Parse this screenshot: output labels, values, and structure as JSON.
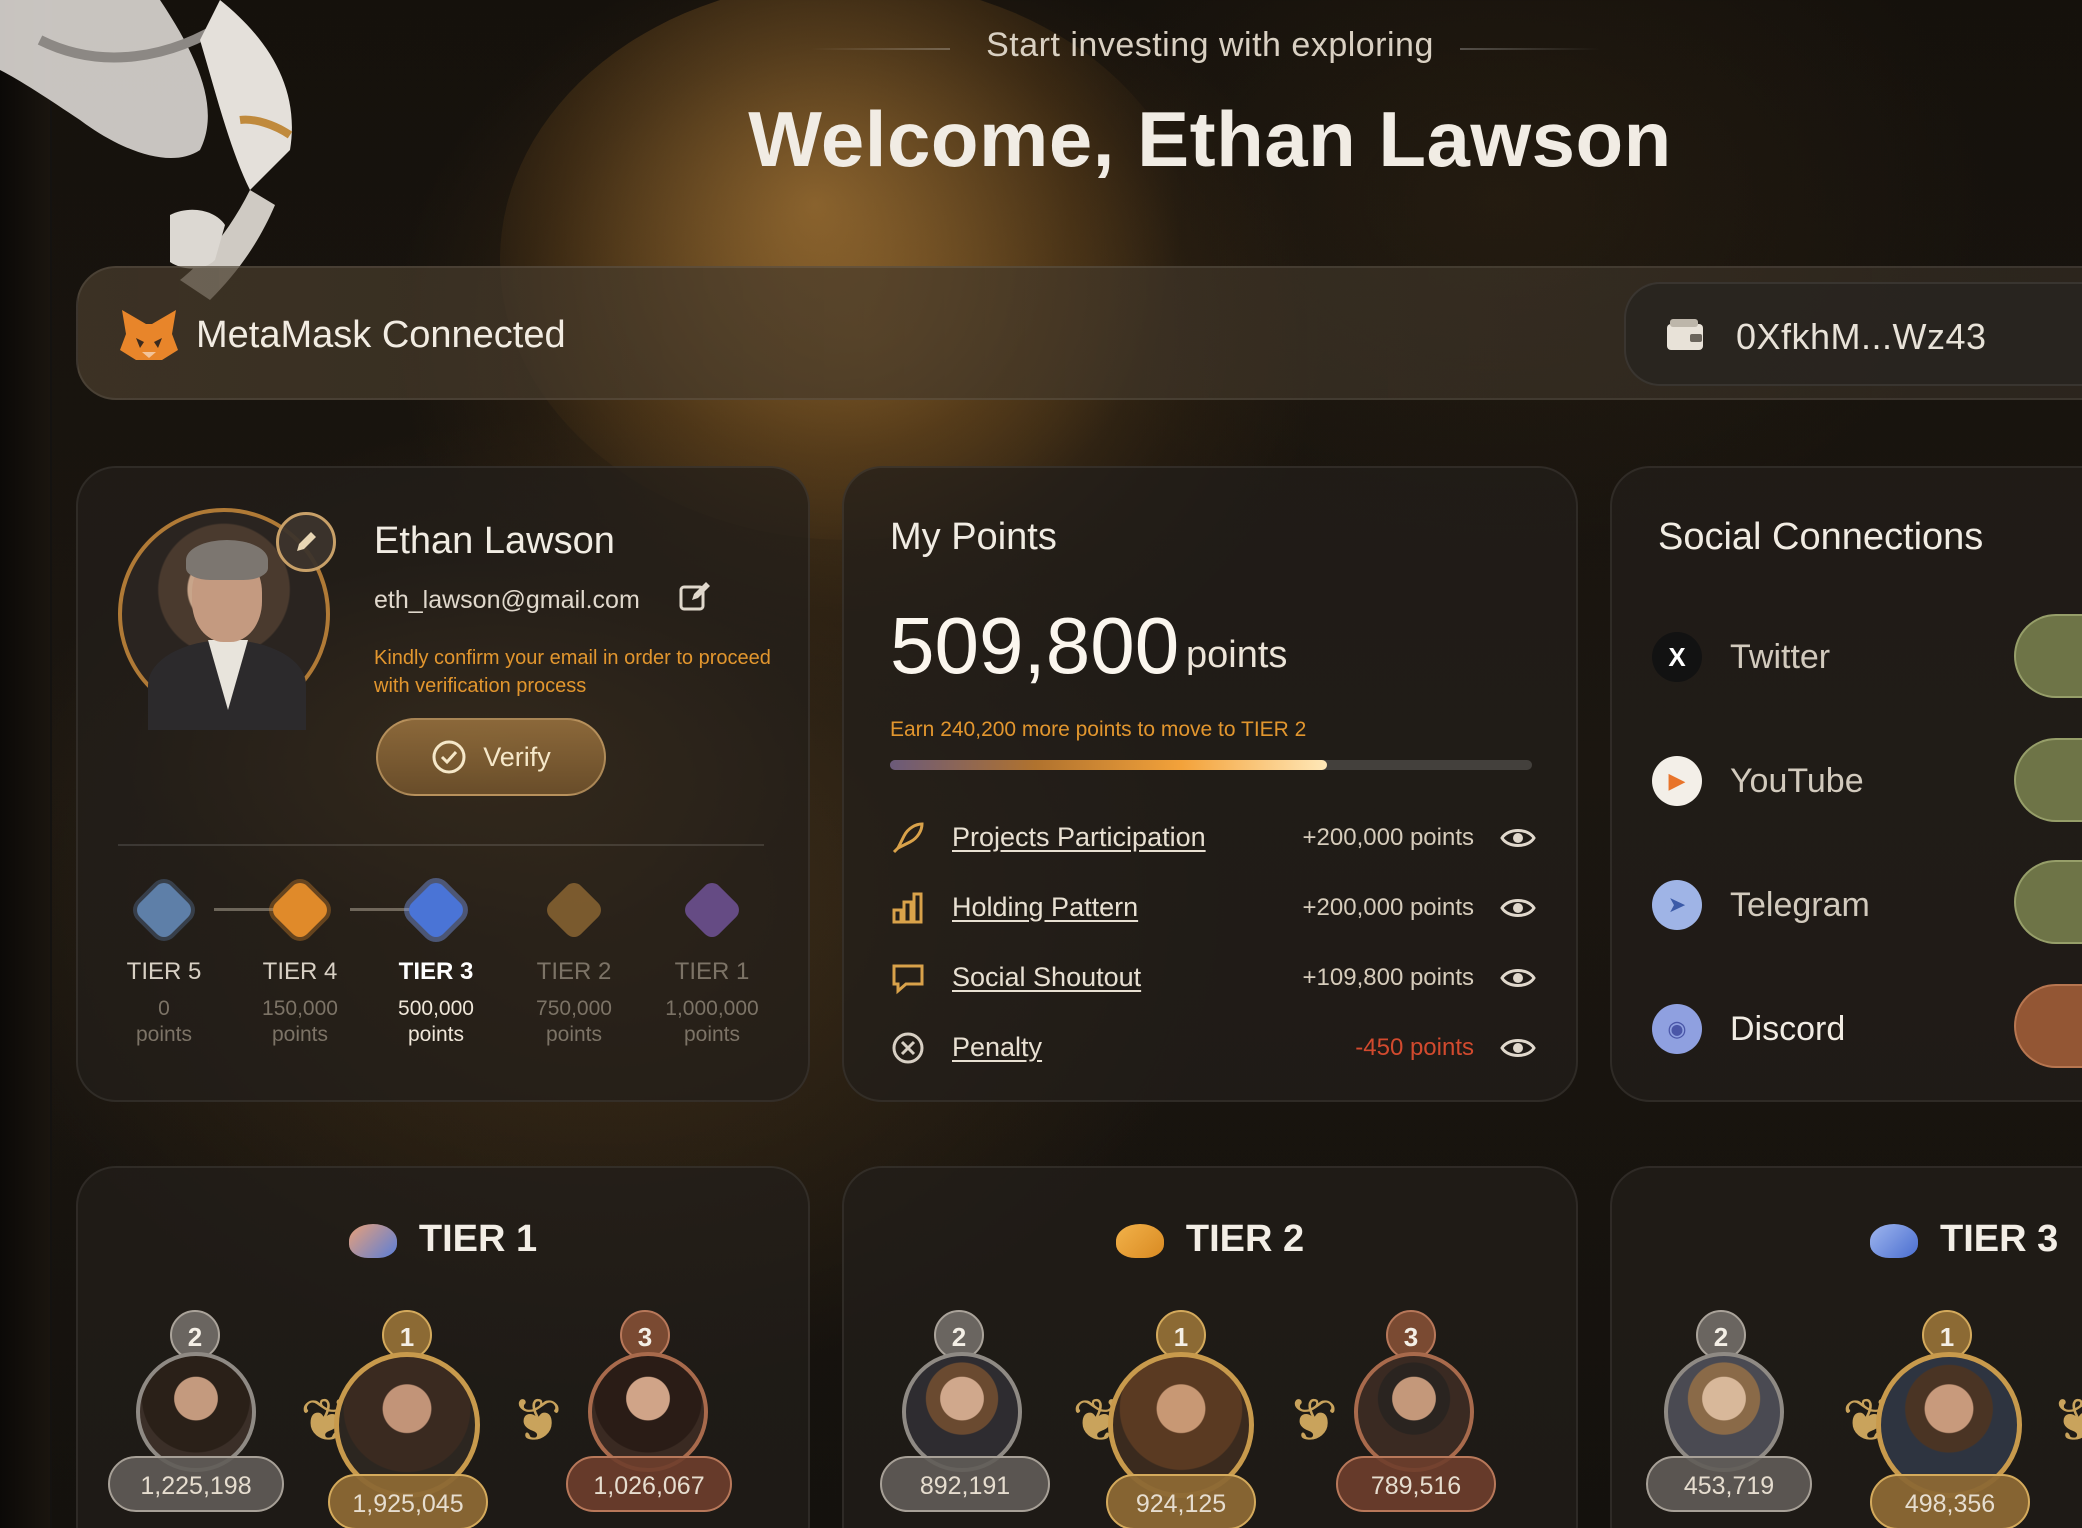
{
  "header": {
    "subtitle": "Start investing with exploring",
    "title": "Welcome, Ethan Lawson"
  },
  "wallet": {
    "status": "MetaMask Connected",
    "address": "0XfkhM...Wz43"
  },
  "profile": {
    "name": "Ethan Lawson",
    "email": "eth_lawson@gmail.com",
    "warning": "Kindly confirm your email in order to proceed with verification process",
    "verify_label": "Verify",
    "tiers": [
      {
        "name": "TIER 5",
        "points": "0",
        "unit": "points",
        "state": "done"
      },
      {
        "name": "TIER 4",
        "points": "150,000",
        "unit": "points",
        "state": "done"
      },
      {
        "name": "TIER 3",
        "points": "500,000",
        "unit": "points",
        "state": "current"
      },
      {
        "name": "TIER 2",
        "points": "750,000",
        "unit": "points",
        "state": "locked"
      },
      {
        "name": "TIER 1",
        "points": "1,000,000",
        "unit": "points",
        "state": "locked"
      }
    ]
  },
  "points": {
    "title": "My Points",
    "value": "509,800",
    "unit": "points",
    "note": "Earn 240,200 more points to move to TIER 2",
    "progress": 0.68,
    "rows": [
      {
        "label": "Projects Participation",
        "value": "+200,000 points",
        "icon": "rocket-icon"
      },
      {
        "label": "Holding Pattern",
        "value": "+200,000 points",
        "icon": "bar-chart-icon"
      },
      {
        "label": "Social Shoutout",
        "value": "+109,800 points",
        "icon": "chat-icon"
      },
      {
        "label": "Penalty",
        "value": "-450 points",
        "icon": "penalty-icon"
      }
    ]
  },
  "social": {
    "title": "Social Connections",
    "items": [
      {
        "label": "Twitter",
        "icon": "x-icon",
        "glyph": "X",
        "connected": true
      },
      {
        "label": "YouTube",
        "icon": "youtube-icon",
        "glyph": "▶",
        "connected": true
      },
      {
        "label": "Telegram",
        "icon": "telegram-icon",
        "glyph": "➤",
        "connected": true
      },
      {
        "label": "Discord",
        "icon": "discord-icon",
        "glyph": "◉",
        "connected": false
      }
    ]
  },
  "leaderboards": [
    {
      "title": "TIER 1",
      "entries": [
        {
          "rank": "2",
          "score": "1,225,198"
        },
        {
          "rank": "1",
          "score": "1,925,045"
        },
        {
          "rank": "3",
          "score": "1,026,067"
        }
      ]
    },
    {
      "title": "TIER 2",
      "entries": [
        {
          "rank": "2",
          "score": "892,191"
        },
        {
          "rank": "1",
          "score": "924,125"
        },
        {
          "rank": "3",
          "score": "789,516"
        }
      ]
    },
    {
      "title": "TIER 3",
      "entries": [
        {
          "rank": "2",
          "score": "453,719"
        },
        {
          "rank": "1",
          "score": "498,356"
        }
      ]
    }
  ],
  "colors": {
    "accent": "#e2962e",
    "gold": "#c9a35c",
    "penalty": "#d24a2e",
    "toggle_on": "#7d8450",
    "toggle_off": "#a8603a"
  }
}
